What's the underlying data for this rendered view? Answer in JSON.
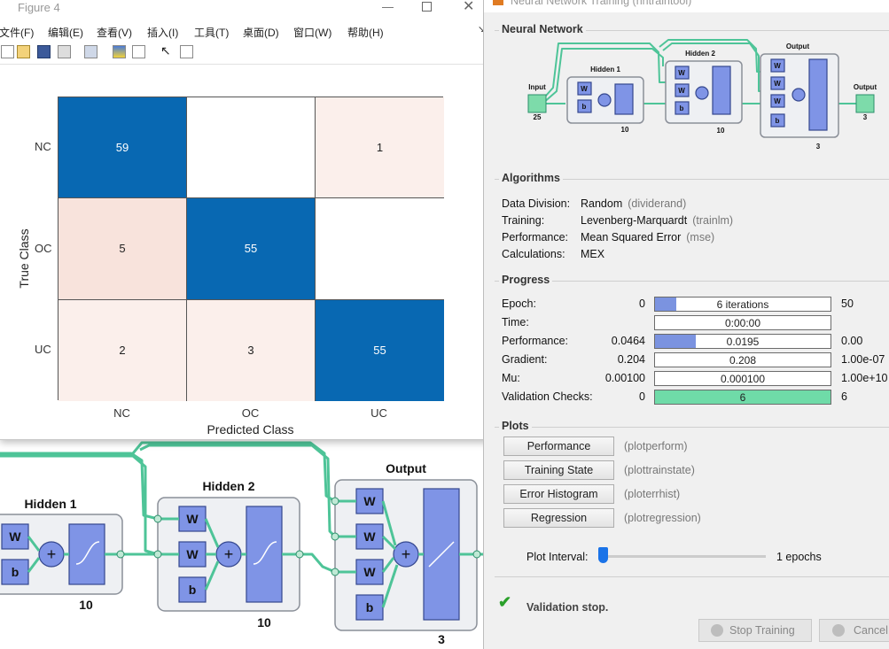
{
  "figure": {
    "title": "Figure 4",
    "menu": [
      "文件(F)",
      "编辑(E)",
      "查看(V)",
      "插入(I)",
      "工具(T)",
      "桌面(D)",
      "窗口(W)",
      "帮助(H)"
    ],
    "chart_data": {
      "type": "heatmap",
      "xlabel": "Predicted Class",
      "ylabel": "True Class",
      "x_categories": [
        "NC",
        "OC",
        "UC"
      ],
      "y_categories": [
        "NC",
        "OC",
        "UC"
      ],
      "cells": [
        [
          "59",
          "",
          "1"
        ],
        [
          "5",
          "55",
          ""
        ],
        [
          "2",
          "3",
          "55"
        ]
      ],
      "colors": {
        "high": "#0868b2",
        "low": "#fbefeb",
        "mid": "#f8e3dc",
        "empty": "#ffffff"
      }
    }
  },
  "nntool": {
    "title": "Neural Network Training (nntraintool)",
    "network": {
      "section": "Neural Network",
      "input": "Input",
      "input_n": "25",
      "h1": "Hidden 1",
      "h1_n": "10",
      "h2": "Hidden 2",
      "h2_n": "10",
      "out": "Output",
      "out_n": "3",
      "output": "Output",
      "output_n": "3",
      "w": "W",
      "b": "b"
    },
    "algorithms": {
      "section": "Algorithms",
      "rows": [
        {
          "k": "Data Division:",
          "v": "Random",
          "f": "(dividerand)"
        },
        {
          "k": "Training:",
          "v": "Levenberg-Marquardt",
          "f": "(trainlm)"
        },
        {
          "k": "Performance:",
          "v": "Mean Squared Error",
          "f": "(mse)"
        },
        {
          "k": "Calculations:",
          "v": "MEX",
          "f": ""
        }
      ]
    },
    "progress": {
      "section": "Progress",
      "rows": [
        {
          "k": "Epoch:",
          "min": "0",
          "val": "6 iterations",
          "max": "50",
          "fill": 0.12,
          "color": "#7b93e0"
        },
        {
          "k": "Time:",
          "min": "",
          "val": "0:00:00",
          "max": "",
          "fill": 0,
          "color": "#7b93e0"
        },
        {
          "k": "Performance:",
          "min": "0.0464",
          "val": "0.0195",
          "max": "0.00",
          "fill": 0.23,
          "color": "#7b93e0"
        },
        {
          "k": "Gradient:",
          "min": "0.204",
          "val": "0.208",
          "max": "1.00e-07",
          "fill": 0,
          "color": "#7b93e0"
        },
        {
          "k": "Mu:",
          "min": "0.00100",
          "val": "0.000100",
          "max": "1.00e+10",
          "fill": 0,
          "color": "#7b93e0"
        },
        {
          "k": "Validation Checks:",
          "min": "0",
          "val": "6",
          "max": "6",
          "fill": 1,
          "color": "#6fdba8"
        }
      ]
    },
    "plots": {
      "section": "Plots",
      "buttons": [
        {
          "label": "Performance",
          "fn": "(plotperform)"
        },
        {
          "label": "Training State",
          "fn": "(plottrainstate)"
        },
        {
          "label": "Error Histogram",
          "fn": "(ploterrhist)"
        },
        {
          "label": "Regression",
          "fn": "(plotregression)"
        }
      ],
      "interval_label": "Plot Interval:",
      "interval_value": "1 epochs"
    },
    "status": "Validation stop.",
    "stop_btn": "Stop Training",
    "cancel_btn": "Cancel"
  },
  "bg_diagram": {
    "h1": "Hidden 1",
    "h1_n": "10",
    "h2": "Hidden 2",
    "h2_n": "10",
    "out": "Output",
    "out_n": "3",
    "w": "W",
    "b": "b"
  }
}
